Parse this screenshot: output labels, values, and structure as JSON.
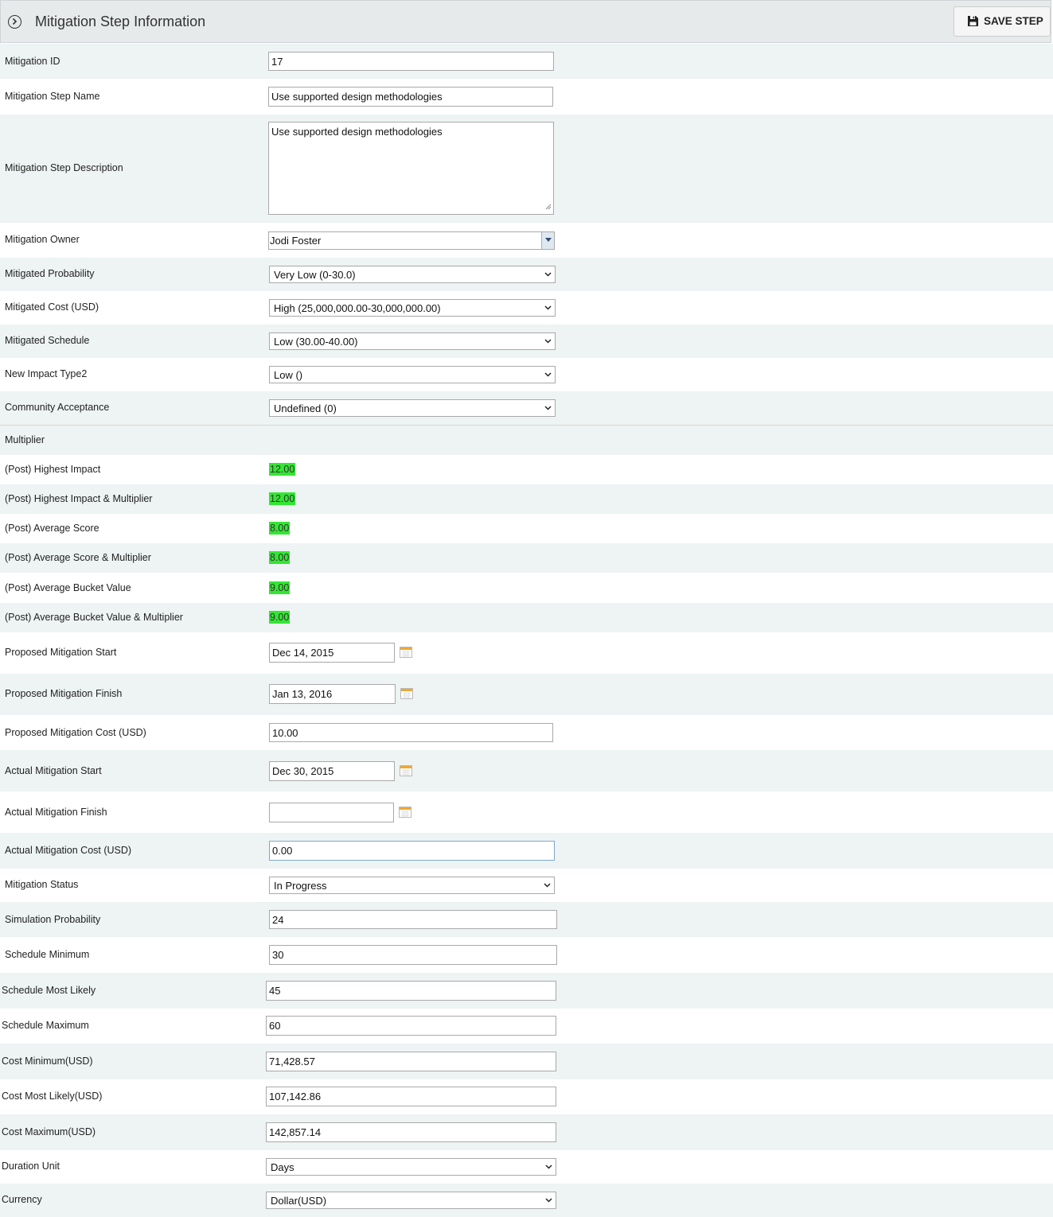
{
  "header": {
    "title": "Mitigation Step Information",
    "save_label": "SAVE STEP"
  },
  "fields": {
    "mitigation_id": {
      "label": "Mitigation ID",
      "value": "17"
    },
    "step_name": {
      "label": "Mitigation Step Name",
      "value": "Use supported design methodologies"
    },
    "step_description": {
      "label": "Mitigation Step Description",
      "value": "Use supported design methodologies"
    },
    "owner": {
      "label": "Mitigation Owner",
      "value": "Jodi Foster"
    },
    "mitigated_probability": {
      "label": "Mitigated Probability",
      "value": "Very Low (0-30.0)"
    },
    "mitigated_cost": {
      "label": "Mitigated Cost (USD)",
      "value": "High (25,000,000.00-30,000,000.00)"
    },
    "mitigated_schedule": {
      "label": "Mitigated Schedule",
      "value": "Low (30.00-40.00)"
    },
    "new_impact_type2": {
      "label": "New Impact Type2",
      "value": "Low ()"
    },
    "community_acceptance": {
      "label": "Community Acceptance",
      "value": "Undefined (0)"
    },
    "multiplier": {
      "label": "Multiplier"
    },
    "post_highest_impact": {
      "label": "(Post) Highest Impact",
      "value": "12.00"
    },
    "post_highest_impact_mult": {
      "label": "(Post) Highest Impact & Multiplier",
      "value": "12.00"
    },
    "post_average_score": {
      "label": "(Post) Average Score",
      "value": "8.00"
    },
    "post_average_score_mult": {
      "label": "(Post) Average Score & Multiplier",
      "value": "8.00"
    },
    "post_average_bucket": {
      "label": "(Post) Average Bucket Value",
      "value": "9.00"
    },
    "post_average_bucket_mult": {
      "label": "(Post) Average Bucket Value & Multiplier",
      "value": "9.00"
    },
    "proposed_start": {
      "label": "Proposed Mitigation Start",
      "value": "Dec 14, 2015"
    },
    "proposed_finish": {
      "label": "Proposed Mitigation Finish",
      "value": "Jan 13, 2016"
    },
    "proposed_cost": {
      "label": "Proposed Mitigation Cost (USD)",
      "value": "10.00"
    },
    "actual_start": {
      "label": "Actual Mitigation Start",
      "value": "Dec 30, 2015"
    },
    "actual_finish": {
      "label": "Actual Mitigation Finish",
      "value": ""
    },
    "actual_cost": {
      "label": "Actual Mitigation Cost (USD)",
      "value": "0.00"
    },
    "status": {
      "label": "Mitigation Status",
      "value": "In Progress"
    },
    "simulation_probability": {
      "label": "Simulation Probability",
      "value": "24"
    },
    "schedule_minimum": {
      "label": "Schedule Minimum",
      "value": "30"
    },
    "schedule_most_likely": {
      "label": "Schedule Most Likely",
      "value": "45"
    },
    "schedule_maximum": {
      "label": "Schedule Maximum",
      "value": "60"
    },
    "cost_minimum": {
      "label": "Cost Minimum(USD)",
      "value": "71,428.57"
    },
    "cost_most_likely": {
      "label": "Cost Most Likely(USD)",
      "value": "107,142.86"
    },
    "cost_maximum": {
      "label": "Cost Maximum(USD)",
      "value": "142,857.14"
    },
    "duration_unit": {
      "label": "Duration Unit",
      "value": "Days"
    },
    "currency": {
      "label": "Currency",
      "value": "Dollar(USD)"
    }
  },
  "colors": {
    "highlight": "#33e633",
    "row_alt": "#eef3f3",
    "header_bg": "#e7eaeb"
  },
  "icons": {
    "header": "chevron-circle-right-icon",
    "save": "floppy-disk-icon",
    "date": "calendar-icon",
    "select": "chevron-down-icon"
  }
}
